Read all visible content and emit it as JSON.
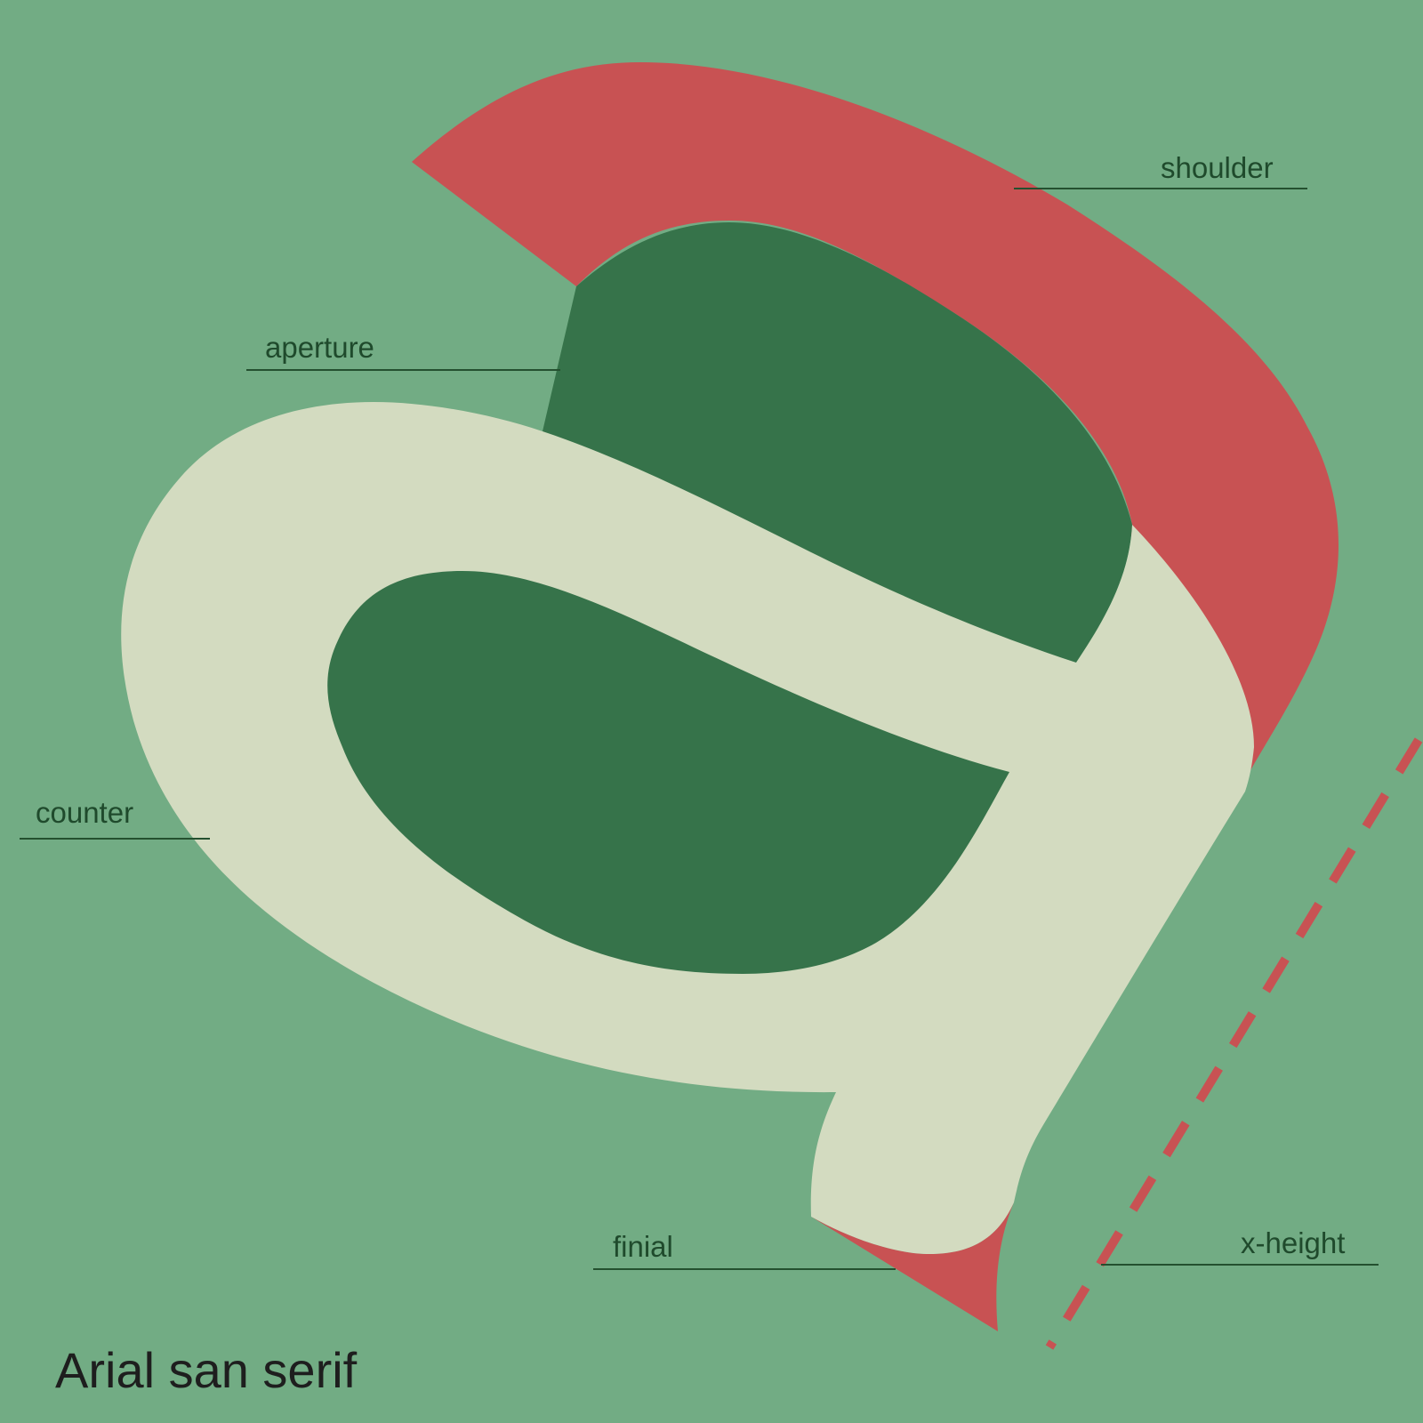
{
  "diagram": {
    "caption": "Arial san serif",
    "labels": {
      "shoulder": "shoulder",
      "aperture": "aperture",
      "counter": "counter",
      "finial": "finial",
      "x_height": "x-height"
    },
    "colors": {
      "background": "#72ac84",
      "letter": "#d3dbc0",
      "counter": "#36734a",
      "highlight": "#c85253",
      "label_text": "#1f4a2c",
      "caption_text": "#1e1e1e"
    }
  }
}
